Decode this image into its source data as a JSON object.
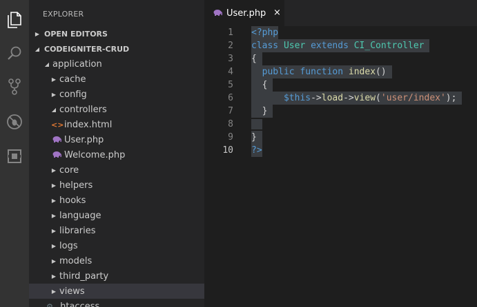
{
  "activity": {
    "icons": [
      "files-icon",
      "search-icon",
      "source-control-icon",
      "debug-icon",
      "extensions-icon"
    ]
  },
  "sidebar": {
    "title": "EXPLORER",
    "open_editors": "OPEN EDITORS",
    "project": "CODEIGNITER-CRUD",
    "tree": [
      {
        "label": "application",
        "kind": "folder-open"
      },
      {
        "label": "cache",
        "kind": "folder"
      },
      {
        "label": "config",
        "kind": "folder"
      },
      {
        "label": "controllers",
        "kind": "folder-open"
      },
      {
        "label": "index.html",
        "kind": "html"
      },
      {
        "label": "User.php",
        "kind": "php"
      },
      {
        "label": "Welcome.php",
        "kind": "php"
      },
      {
        "label": "core",
        "kind": "folder"
      },
      {
        "label": "helpers",
        "kind": "folder"
      },
      {
        "label": "hooks",
        "kind": "folder"
      },
      {
        "label": "language",
        "kind": "folder"
      },
      {
        "label": "libraries",
        "kind": "folder"
      },
      {
        "label": "logs",
        "kind": "folder"
      },
      {
        "label": "models",
        "kind": "folder"
      },
      {
        "label": "third_party",
        "kind": "folder"
      },
      {
        "label": "views",
        "kind": "folder",
        "selected": true
      },
      {
        "label": ".htaccess",
        "kind": "gear"
      }
    ]
  },
  "tab": {
    "label": "User.php",
    "close": "×"
  },
  "editor": {
    "line_numbers": [
      "1",
      "2",
      "3",
      "4",
      "5",
      "6",
      "7",
      "8",
      "9",
      "10"
    ],
    "lines": {
      "l1": "<?php",
      "l2_class": "class",
      "l2_name": "User",
      "l2_extends": "extends",
      "l2_parent": "CI_Controller",
      "l3": "{",
      "l4_public": "public",
      "l4_function": "function",
      "l4_name": "index",
      "l4_parens": "()",
      "l5": "{",
      "l6_this": "$this",
      "l6_arrow1": "->",
      "l6_load": "load",
      "l6_arrow2": "->",
      "l6_view": "view",
      "l6_open": "(",
      "l6_str": "'user/index'",
      "l6_close": ");",
      "l7": "}",
      "l9": "}",
      "l10": "?>"
    }
  }
}
